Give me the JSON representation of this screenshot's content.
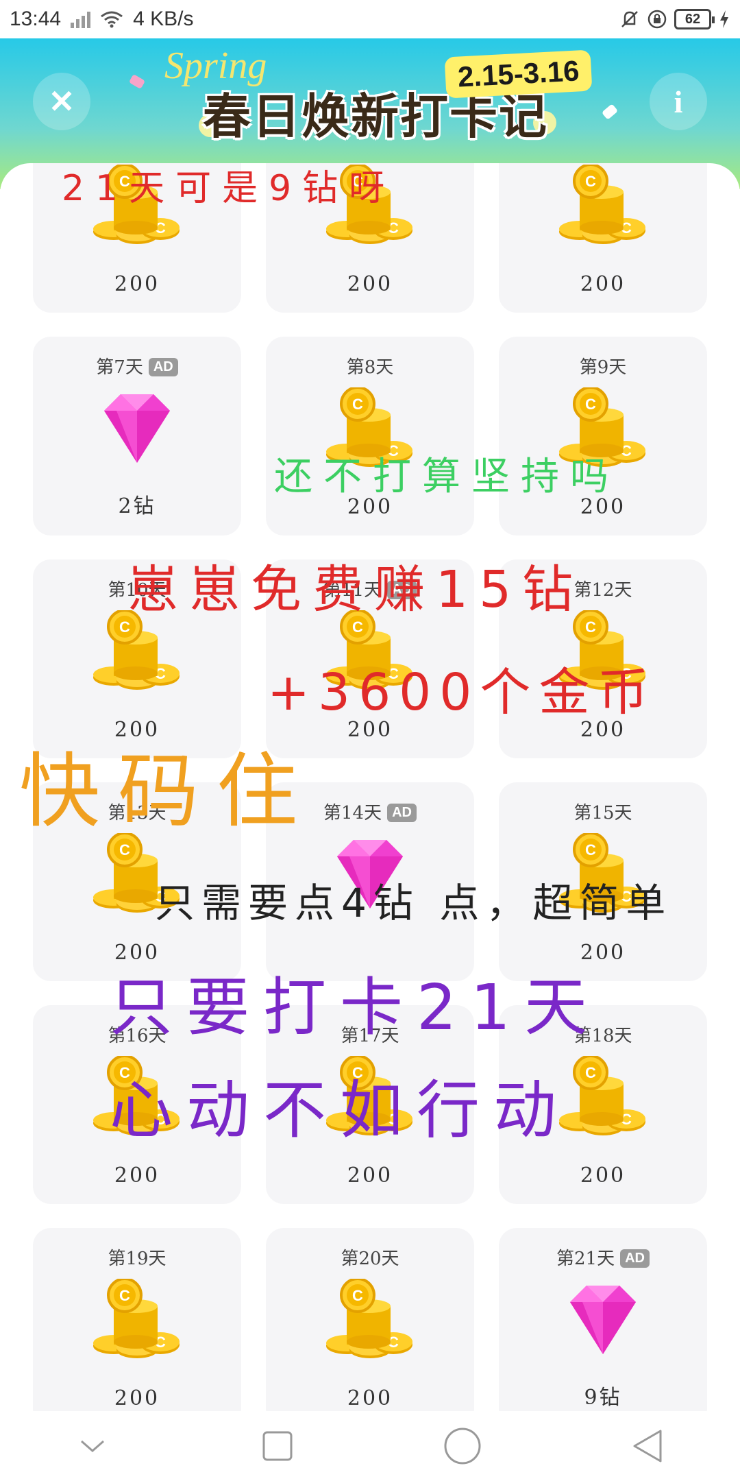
{
  "status_bar": {
    "time": "13:44",
    "net_speed": "4 KB/s",
    "battery": "62"
  },
  "header": {
    "title": "春日焕新打卡记",
    "date_range": "2.15-3.16",
    "spring_text": "Spring"
  },
  "cards": [
    {
      "day": "",
      "ad": false,
      "reward": "coin",
      "value": "200"
    },
    {
      "day": "",
      "ad": false,
      "reward": "coin",
      "value": "200"
    },
    {
      "day": "",
      "ad": false,
      "reward": "coin",
      "value": "200"
    },
    {
      "day": "第7天",
      "ad": true,
      "reward": "diamond",
      "value": "2钻"
    },
    {
      "day": "第8天",
      "ad": false,
      "reward": "coin",
      "value": "200"
    },
    {
      "day": "第9天",
      "ad": false,
      "reward": "coin",
      "value": "200"
    },
    {
      "day": "第10天",
      "ad": false,
      "reward": "coin",
      "value": "200"
    },
    {
      "day": "第11天",
      "ad": true,
      "reward": "coin",
      "value": "200"
    },
    {
      "day": "第12天",
      "ad": false,
      "reward": "coin",
      "value": "200"
    },
    {
      "day": "第13天",
      "ad": false,
      "reward": "coin",
      "value": "200"
    },
    {
      "day": "第14天",
      "ad": true,
      "reward": "diamond",
      "value": ""
    },
    {
      "day": "第15天",
      "ad": false,
      "reward": "coin",
      "value": "200"
    },
    {
      "day": "第16天",
      "ad": false,
      "reward": "coin",
      "value": "200"
    },
    {
      "day": "第17天",
      "ad": false,
      "reward": "coin",
      "value": "200"
    },
    {
      "day": "第18天",
      "ad": false,
      "reward": "coin",
      "value": "200"
    },
    {
      "day": "第19天",
      "ad": false,
      "reward": "coin",
      "value": "200"
    },
    {
      "day": "第20天",
      "ad": false,
      "reward": "coin",
      "value": "200"
    },
    {
      "day": "第21天",
      "ad": true,
      "reward": "diamond",
      "value": "9钻"
    }
  ],
  "ad_badge": "AD",
  "overlays": {
    "line1": "21天可是9钻呀",
    "line2": "还不打算坚持吗",
    "line3": "崽崽免费赚15钻",
    "line4": "+3600个金币",
    "line5": "快码住",
    "line6": "只需要点4钻 点，超简单",
    "line7": "只要打卡21天",
    "line8": "心动不如行动"
  },
  "colors": {
    "red": "#e02a2a",
    "green": "#3ccf62",
    "orange": "#f0a020",
    "purple": "#7a28c8",
    "black": "#222222"
  }
}
